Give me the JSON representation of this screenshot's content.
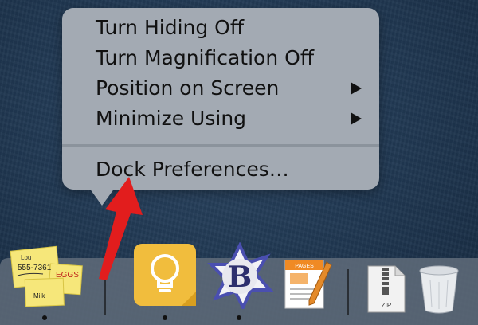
{
  "context_menu": {
    "items": [
      {
        "label": "Turn Hiding Off",
        "has_submenu": false
      },
      {
        "label": "Turn Magnification Off",
        "has_submenu": false
      },
      {
        "label": "Position on Screen",
        "has_submenu": true
      },
      {
        "label": "Minimize Using",
        "has_submenu": true
      }
    ],
    "footer_item": {
      "label": "Dock Preferences…"
    }
  },
  "annotation": {
    "arrow_color": "#e21d1d",
    "icon": "red-arrow-icon"
  },
  "dock": {
    "apps": [
      {
        "name": "Stickies",
        "icon": "stickies-icon",
        "running": true,
        "notes": {
          "line1": "Lou",
          "line2": "555-7361",
          "line3": "EGGS",
          "line4": "Milk"
        }
      },
      {
        "name": "Tips",
        "icon": "lightbulb-icon",
        "running": true
      },
      {
        "name": "BBEdit",
        "icon": "bbedit-icon",
        "running": true,
        "glyph": "B"
      },
      {
        "name": "Pages",
        "icon": "pages-icon",
        "running": false,
        "badge": "PAGES"
      }
    ],
    "right_items": [
      {
        "name": "Archive",
        "icon": "zip-archive-icon",
        "badge": "ZIP"
      },
      {
        "name": "Trash",
        "icon": "trash-icon"
      }
    ]
  }
}
